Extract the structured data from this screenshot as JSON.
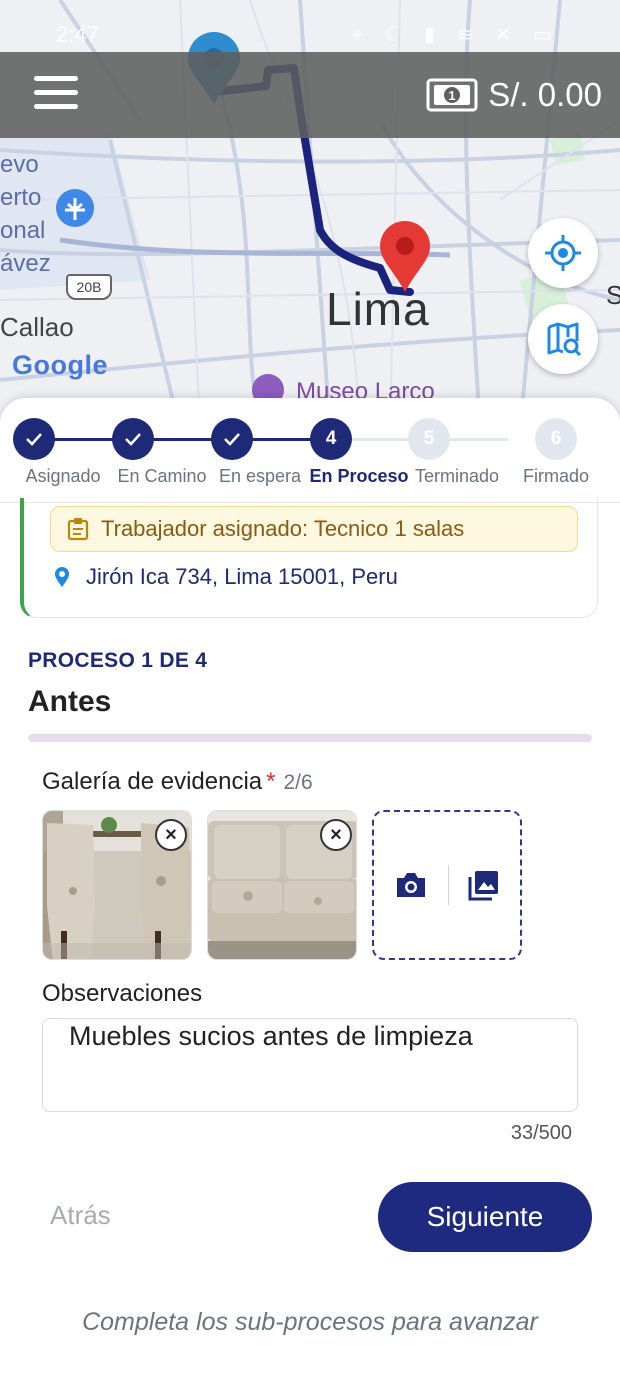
{
  "status_bar": {
    "time": "2:47",
    "icons": "⌖ ☾ ▮ ≋ ✕ ▭"
  },
  "top_bar": {
    "balance": "S/. 0.00"
  },
  "map": {
    "airport_label": [
      "evo",
      "erto",
      "onal",
      "ávez"
    ],
    "route_shield": "20B",
    "city_label": "Lima",
    "district_label": "Callao",
    "poi_label": "Museo Larco",
    "edge_label": "S",
    "attribution": "Google",
    "origin_pin_color": "#2e8ccf",
    "destination_pin_color": "#e53935",
    "route_color": "#1a237e"
  },
  "stepper": {
    "steps": [
      {
        "label": "Asignado",
        "number": "1",
        "state": "done"
      },
      {
        "label": "En Camino",
        "number": "2",
        "state": "done"
      },
      {
        "label": "En espera",
        "number": "3",
        "state": "done"
      },
      {
        "label": "En Proceso",
        "number": "4",
        "state": "active"
      },
      {
        "label": "Terminado",
        "number": "5",
        "state": "pending"
      },
      {
        "label": "Firmado",
        "number": "6",
        "state": "pending"
      }
    ]
  },
  "order_card": {
    "assignment": "Trabajador asignado: Tecnico 1 salas",
    "address": "Jirón Ica 734, Lima 15001, Peru"
  },
  "process": {
    "label": "PROCESO 1 DE 4",
    "title": "Antes"
  },
  "gallery": {
    "label": "Galería de evidencia",
    "required_mark": "*",
    "count": "2/6",
    "photos": [
      "chairs-photo",
      "sofa-photo"
    ]
  },
  "observations": {
    "label": "Observaciones",
    "value": "Muebles sucios antes de limpieza",
    "counter": "33/500"
  },
  "actions": {
    "back": "Atrás",
    "next": "Siguiente",
    "hint": "Completa los sub-procesos para avanzar"
  },
  "colors": {
    "primary": "#1e2a80",
    "done_step": "#1e2a78",
    "pending_step": "#e2e6ef",
    "card_accent": "#3fa34d",
    "banner_bg": "#fff8e1"
  }
}
